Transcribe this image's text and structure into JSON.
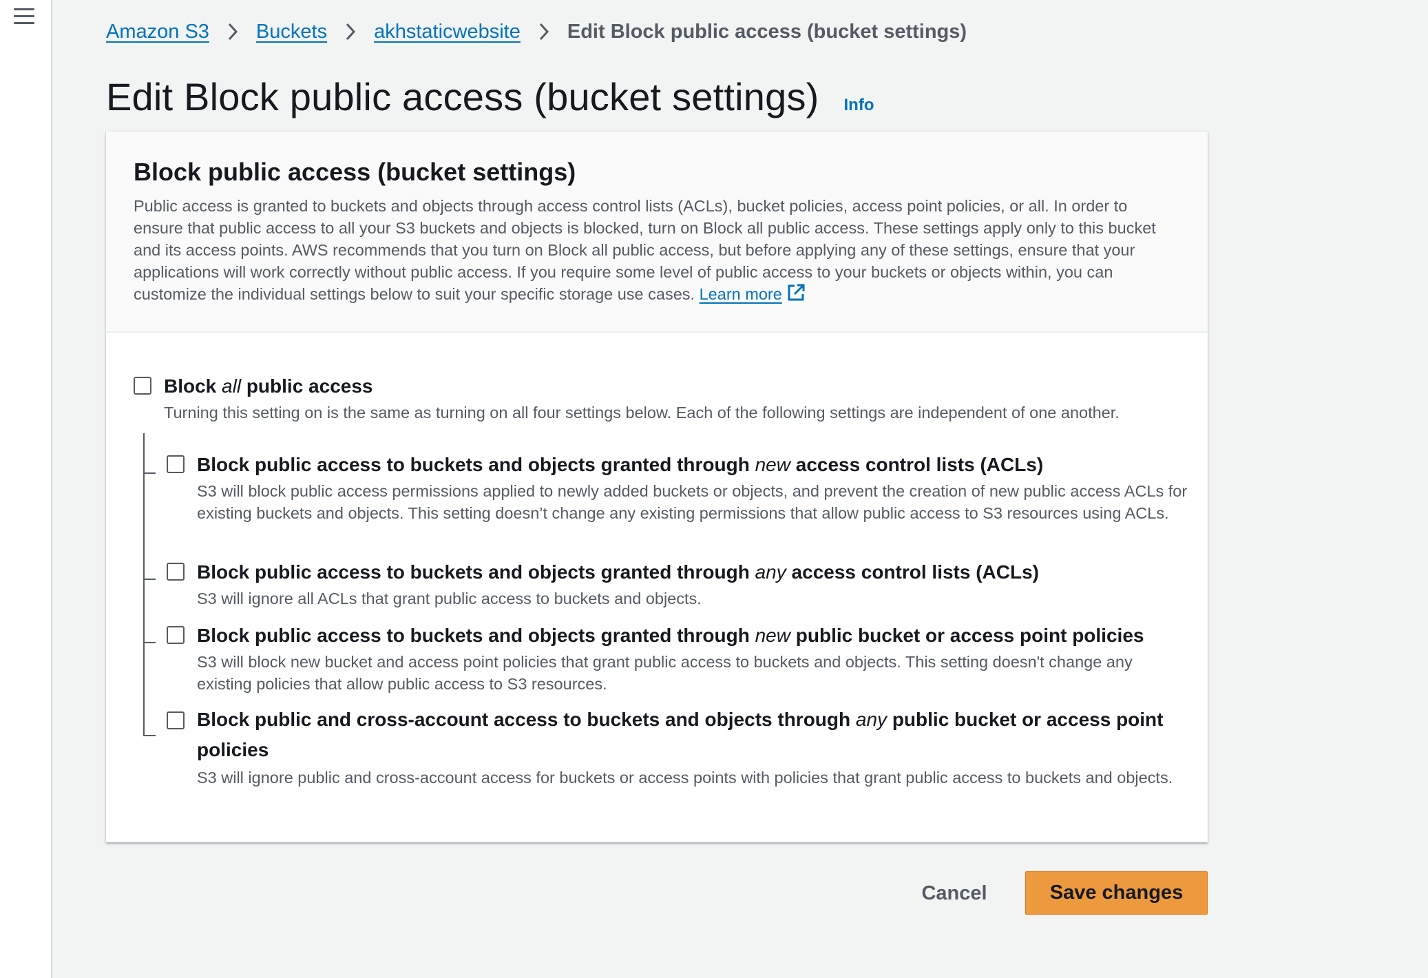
{
  "nav": {
    "menu_icon": "hamburger-menu-icon"
  },
  "breadcrumb": {
    "items": [
      "Amazon S3",
      "Buckets",
      "akhstaticwebsite"
    ],
    "current": "Edit Block public access (bucket settings)"
  },
  "page": {
    "title": "Edit Block public access (bucket settings)",
    "info_label": "Info"
  },
  "panel": {
    "title": "Block public access (bucket settings)",
    "description": "Public access is granted to buckets and objects through access control lists (ACLs), bucket policies, access point policies, or all. In order to ensure that public access to all your S3 buckets and objects is blocked, turn on Block all public access. These settings apply only to this bucket and its access points. AWS recommends that you turn on Block all public access, but before applying any of these settings, ensure that your applications will work correctly without public access. If you require some level of public access to your buckets or objects within, you can customize the individual settings below to suit your specific storage use cases.",
    "learn_more": "Learn more",
    "learn_more_icon": "external-link-icon"
  },
  "options": {
    "block_all": {
      "prefix": "Block ",
      "emph": "all",
      "suffix": " public access",
      "description": "Turning this setting on is the same as turning on all four settings below. Each of the following settings are independent of one another.",
      "checked": false
    },
    "sub": [
      {
        "prefix": "Block public access to buckets and objects granted through ",
        "emph": "new",
        "suffix": " access control lists (ACLs)",
        "description": "S3 will block public access permissions applied to newly added buckets or objects, and prevent the creation of new public access ACLs for existing buckets and objects. This setting doesn’t change any existing permissions that allow public access to S3 resources using ACLs.",
        "checked": false
      },
      {
        "prefix": "Block public access to buckets and objects granted through ",
        "emph": "any",
        "suffix": " access control lists (ACLs)",
        "description": "S3 will ignore all ACLs that grant public access to buckets and objects.",
        "checked": false
      },
      {
        "prefix": "Block public access to buckets and objects granted through ",
        "emph": "new",
        "suffix": " public bucket or access point policies",
        "description": "S3 will block new bucket and access point policies that grant public access to buckets and objects. This setting doesn't change any existing policies that allow public access to S3 resources.",
        "checked": false
      },
      {
        "prefix": "Block public and cross-account access to buckets and objects through ",
        "emph": "any",
        "suffix": " public bucket or access point policies",
        "description": "S3 will ignore public and cross-account access for buckets or access points with policies that grant public access to buckets and objects.",
        "checked": false
      }
    ]
  },
  "actions": {
    "cancel": "Cancel",
    "save": "Save changes",
    "save_color": "#ec9a3d"
  }
}
